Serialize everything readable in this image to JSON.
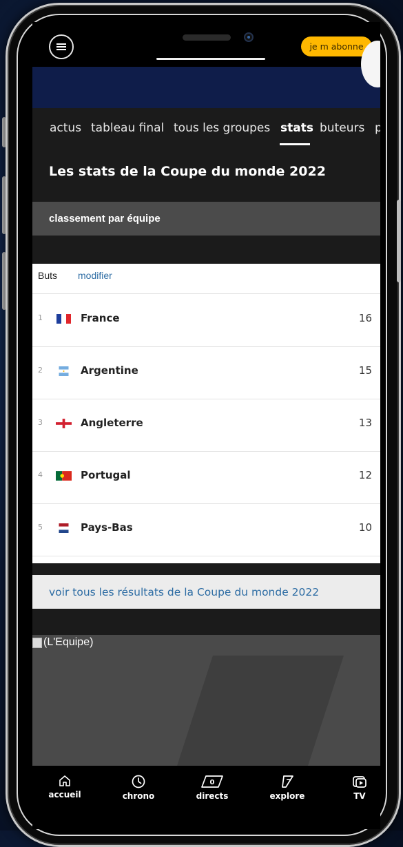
{
  "app": {
    "subscribe_label": "je m abonne"
  },
  "tabs": [
    {
      "label": "actus"
    },
    {
      "label": "tableau final"
    },
    {
      "label": "tous les groupes"
    },
    {
      "label": "stats"
    },
    {
      "label": "buteurs"
    },
    {
      "label": "p"
    }
  ],
  "headline": "Les stats de la Coupe du monde 2022",
  "section": {
    "title": "classement par équipe"
  },
  "table": {
    "stat_label": "Buts",
    "modify_label": "modifier",
    "rows": [
      {
        "rank": "1",
        "country": "France",
        "goals": "16"
      },
      {
        "rank": "2",
        "country": "Argentine",
        "goals": "15"
      },
      {
        "rank": "3",
        "country": "Angleterre",
        "goals": "13"
      },
      {
        "rank": "4",
        "country": "Portugal",
        "goals": "12"
      },
      {
        "rank": "5",
        "country": "Pays-Bas",
        "goals": "10"
      }
    ]
  },
  "see_all_label": "voir tous les résultats de la Coupe du monde 2022",
  "media": {
    "alt_text": "(L'Equipe)"
  },
  "bottom_nav": [
    {
      "label": "accueil",
      "icon": "home-icon"
    },
    {
      "label": "chrono",
      "icon": "clock-icon"
    },
    {
      "label": "directs",
      "icon": "live-icon",
      "badge": "0"
    },
    {
      "label": "explore",
      "icon": "explore-icon"
    },
    {
      "label": "TV",
      "icon": "tv-icon"
    }
  ],
  "colors": {
    "accent": "#ffb800",
    "link": "#2e6da4",
    "hero": "#0f1d4a"
  }
}
